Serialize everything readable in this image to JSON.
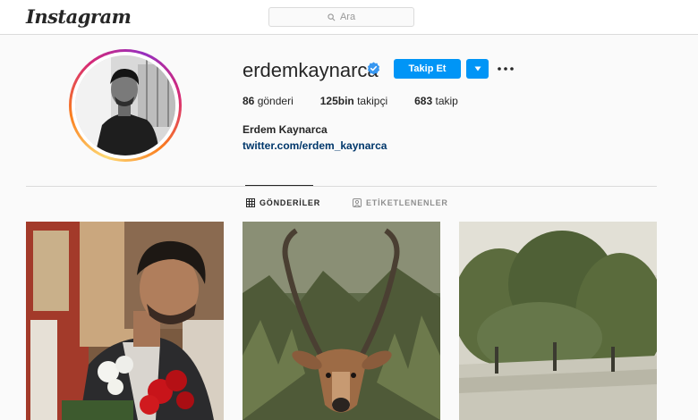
{
  "header": {
    "logo": "Instagram",
    "search_placeholder": "Ara"
  },
  "profile": {
    "username": "erdemkaynarca",
    "verified": true,
    "follow_label": "Takip Et",
    "stats": {
      "posts_count": "86",
      "posts_label": "gönderi",
      "followers_count": "125bin",
      "followers_label": "takipçi",
      "following_count": "683",
      "following_label": "takip"
    },
    "full_name": "Erdem Kaynarca",
    "link": "twitter.com/erdem_kaynarca"
  },
  "tabs": [
    {
      "label": "GÖNDERİLER",
      "active": true
    },
    {
      "label": "ETİKETLENENLER",
      "active": false
    }
  ],
  "colors": {
    "accent": "#0095f6",
    "link": "#00376b",
    "verified": "#3897f0"
  },
  "icons": [
    "search-icon",
    "verified-badge-icon",
    "chevron-down-icon",
    "more-options-icon",
    "grid-icon",
    "tagged-icon"
  ]
}
